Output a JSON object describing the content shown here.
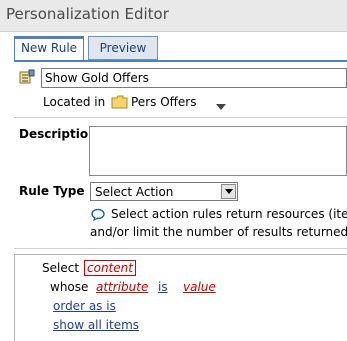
{
  "window": {
    "title": "Personalization Editor"
  },
  "tabs": [
    {
      "label": "New Rule",
      "active": true
    },
    {
      "label": "Preview",
      "active": false
    }
  ],
  "rule": {
    "name_value": "Show Gold Offers",
    "located_label": "Located in",
    "folder_name": "Pers Offers",
    "icon": "rule-icon",
    "folder_icon": "folder-icon"
  },
  "description": {
    "label": "Description",
    "value": ""
  },
  "rule_type": {
    "label": "Rule Type",
    "selected": "Select Action",
    "info_icon": "speech-bubble-icon",
    "info_line1": "Select action rules return resources (ite",
    "info_line2": "and/or limit the number of results returned."
  },
  "builder": {
    "select_label": "Select",
    "content_token": "content",
    "whose_label": "whose",
    "attribute_token": "attribute",
    "operator_token": "is",
    "value_token": "value",
    "order_link": "order as is",
    "show_link": "show all items"
  },
  "colors": {
    "accent_blue": "#4f81bd",
    "link_blue": "#1f3d9a",
    "token_red": "#cc0000",
    "titlebar_bg": "#e9e9e9"
  }
}
